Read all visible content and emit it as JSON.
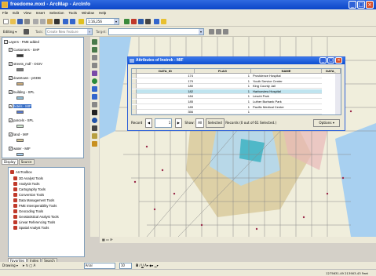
{
  "app": {
    "title": "freedome.mxd - ArcMap - ArcInfo"
  },
  "menu": [
    "File",
    "Edit",
    "View",
    "Insert",
    "Selection",
    "Tools",
    "Window",
    "Help"
  ],
  "standard_toolbar": {
    "scale": "1:16,256"
  },
  "editor_toolbar": {
    "editor_label": "Editing ▾",
    "task_label": "Task:",
    "task_value": "Create New Feature",
    "target_label": "Target:",
    "target_value": ""
  },
  "toc": {
    "root": "Layers - FME added",
    "layers": [
      {
        "name": "Customers - SHP",
        "color": "#333333"
      },
      {
        "name": "streets_mdf - OGIV",
        "color": "#7a7a7a"
      },
      {
        "name": "downtown - pGDB",
        "color": "#c8a878"
      },
      {
        "name": "building - SPL",
        "color": "#90c0d8"
      },
      {
        "name": "hotels - MIF",
        "color": "#5577cc"
      },
      {
        "name": "parcels - SPL",
        "color": "#d0e8d0"
      },
      {
        "name": "land - MIF",
        "color": "#d8c898"
      },
      {
        "name": "water - MIF",
        "color": "#a8d0f0"
      }
    ],
    "tabs": [
      "Display",
      "Source"
    ]
  },
  "toolbox": {
    "root": "ArcToolbox",
    "items": [
      "3D Analyst Tools",
      "Analysis Tools",
      "Cartography Tools",
      "Conversion Tools",
      "Data Management Tools",
      "FME Interoperability Tools",
      "Geocoding Tools",
      "Geostatistical Analyst Tools",
      "Linear Referencing Tools",
      "Spatial Analyst Tools"
    ],
    "tabs": [
      "Favorites",
      "Index",
      "Search"
    ]
  },
  "attr_table": {
    "title": "Attributes of Instrek - MIF",
    "columns": [
      "DATA_ID",
      "FLAG",
      "NAME",
      "DATA_"
    ],
    "rows": [
      {
        "id": "174",
        "flag": "1",
        "name": "Providence Hospital"
      },
      {
        "id": "179",
        "flag": "1",
        "name": "Youth Service Center"
      },
      {
        "id": "180",
        "flag": "1",
        "name": "King County Jail"
      },
      {
        "id": "182",
        "flag": "1",
        "name": "Harborview Hospital"
      },
      {
        "id": "184",
        "flag": "1",
        "name": "Leschi Park"
      },
      {
        "id": "185",
        "flag": "1",
        "name": "Luther Burbank Park"
      },
      {
        "id": "189",
        "flag": "1",
        "name": "Pacific Medical Center"
      },
      {
        "id": "356",
        "flag": "1",
        "name": ""
      }
    ],
    "highlight_row": 3,
    "record_label": "Record",
    "record_value": "1",
    "show_label": "Show:",
    "all_label": "All",
    "selected_label": "Selected",
    "records_text": "Records (0 out of 61 Selected.)",
    "options_label": "Options ▾"
  },
  "drawing_toolbar": {
    "drawing_label": "Drawing ▾",
    "font": "Arial",
    "size": "10"
  },
  "status": {
    "coords": "1275631.49 213903.43 Feet"
  }
}
